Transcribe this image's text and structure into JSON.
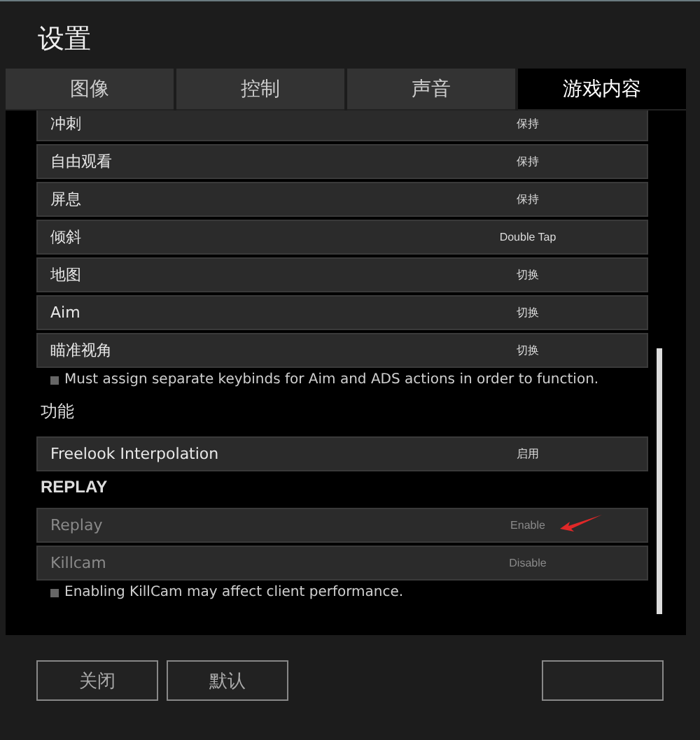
{
  "window": {
    "title": "设置"
  },
  "tabs": [
    {
      "label": "图像",
      "selected": false
    },
    {
      "label": "控制",
      "selected": false
    },
    {
      "label": "声音",
      "selected": false
    },
    {
      "label": "游戏内容",
      "selected": true
    }
  ],
  "content": [
    {
      "kind": "row",
      "label": "冲刺",
      "value": "保持",
      "disabled": false,
      "pointed": false
    },
    {
      "kind": "row",
      "label": "自由观看",
      "value": "保持",
      "disabled": false,
      "pointed": false
    },
    {
      "kind": "row",
      "label": "屏息",
      "value": "保持",
      "disabled": false,
      "pointed": false
    },
    {
      "kind": "row",
      "label": "倾斜",
      "value": "Double Tap",
      "disabled": false,
      "pointed": false
    },
    {
      "kind": "row",
      "label": "地图",
      "value": "切换",
      "disabled": false,
      "pointed": false
    },
    {
      "kind": "row",
      "label": "Aim",
      "value": "切换",
      "disabled": false,
      "pointed": false
    },
    {
      "kind": "row",
      "label": "瞄准视角",
      "value": "切换",
      "disabled": false,
      "pointed": false
    },
    {
      "kind": "note",
      "text": "Must assign separate keybinds for Aim and ADS actions in order to function."
    },
    {
      "kind": "heading",
      "text": "功能"
    },
    {
      "kind": "row",
      "label": "Freelook Interpolation",
      "value": "启用",
      "disabled": false,
      "pointed": false
    },
    {
      "kind": "heading",
      "text": "REPLAY"
    },
    {
      "kind": "row",
      "label": "Replay",
      "value": "Enable",
      "disabled": true,
      "pointed": true
    },
    {
      "kind": "row",
      "label": "Killcam",
      "value": "Disable",
      "disabled": true,
      "pointed": false
    },
    {
      "kind": "note",
      "text": "Enabling KillCam may affect client performance."
    }
  ],
  "footer": {
    "buttons": [
      {
        "label": "关闭"
      },
      {
        "label": "默认"
      }
    ]
  }
}
